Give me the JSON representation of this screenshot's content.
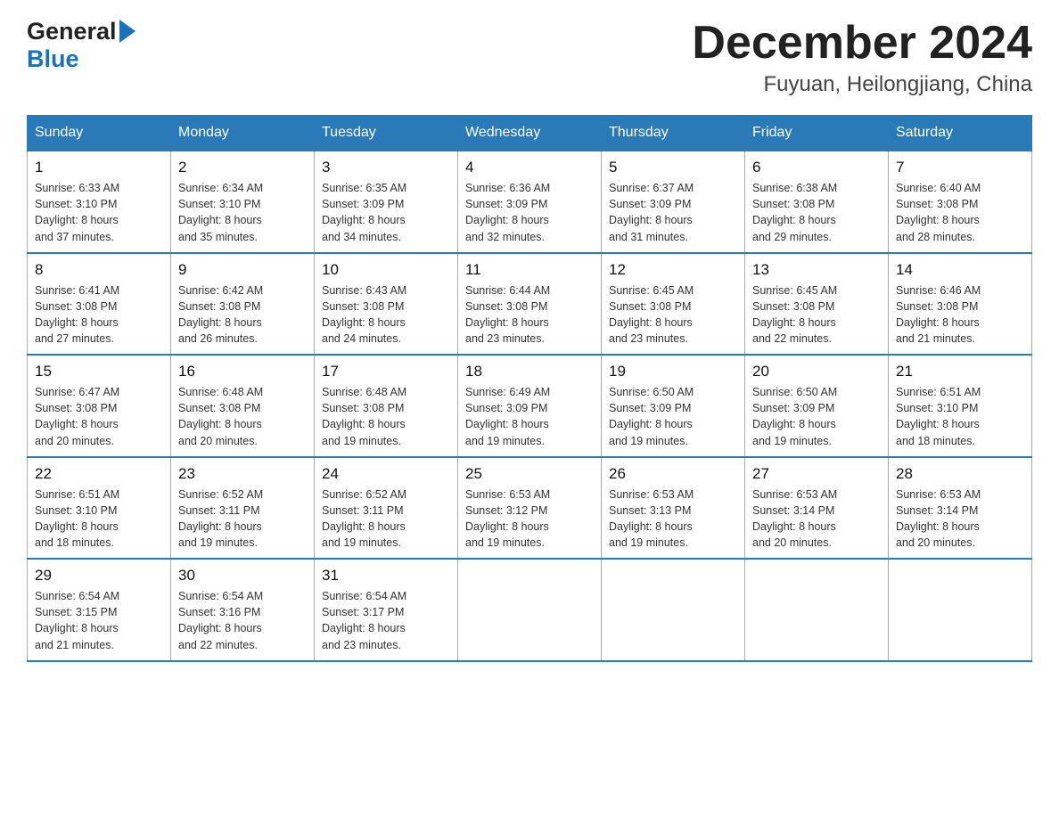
{
  "header": {
    "logo_general": "General",
    "logo_blue": "Blue",
    "month_title": "December 2024",
    "location": "Fuyuan, Heilongjiang, China"
  },
  "weekdays": [
    "Sunday",
    "Monday",
    "Tuesday",
    "Wednesday",
    "Thursday",
    "Friday",
    "Saturday"
  ],
  "weeks": [
    [
      {
        "day": "1",
        "sunrise": "6:33 AM",
        "sunset": "3:10 PM",
        "daylight": "8 hours and 37 minutes."
      },
      {
        "day": "2",
        "sunrise": "6:34 AM",
        "sunset": "3:10 PM",
        "daylight": "8 hours and 35 minutes."
      },
      {
        "day": "3",
        "sunrise": "6:35 AM",
        "sunset": "3:09 PM",
        "daylight": "8 hours and 34 minutes."
      },
      {
        "day": "4",
        "sunrise": "6:36 AM",
        "sunset": "3:09 PM",
        "daylight": "8 hours and 32 minutes."
      },
      {
        "day": "5",
        "sunrise": "6:37 AM",
        "sunset": "3:09 PM",
        "daylight": "8 hours and 31 minutes."
      },
      {
        "day": "6",
        "sunrise": "6:38 AM",
        "sunset": "3:08 PM",
        "daylight": "8 hours and 29 minutes."
      },
      {
        "day": "7",
        "sunrise": "6:40 AM",
        "sunset": "3:08 PM",
        "daylight": "8 hours and 28 minutes."
      }
    ],
    [
      {
        "day": "8",
        "sunrise": "6:41 AM",
        "sunset": "3:08 PM",
        "daylight": "8 hours and 27 minutes."
      },
      {
        "day": "9",
        "sunrise": "6:42 AM",
        "sunset": "3:08 PM",
        "daylight": "8 hours and 26 minutes."
      },
      {
        "day": "10",
        "sunrise": "6:43 AM",
        "sunset": "3:08 PM",
        "daylight": "8 hours and 24 minutes."
      },
      {
        "day": "11",
        "sunrise": "6:44 AM",
        "sunset": "3:08 PM",
        "daylight": "8 hours and 23 minutes."
      },
      {
        "day": "12",
        "sunrise": "6:45 AM",
        "sunset": "3:08 PM",
        "daylight": "8 hours and 23 minutes."
      },
      {
        "day": "13",
        "sunrise": "6:45 AM",
        "sunset": "3:08 PM",
        "daylight": "8 hours and 22 minutes."
      },
      {
        "day": "14",
        "sunrise": "6:46 AM",
        "sunset": "3:08 PM",
        "daylight": "8 hours and 21 minutes."
      }
    ],
    [
      {
        "day": "15",
        "sunrise": "6:47 AM",
        "sunset": "3:08 PM",
        "daylight": "8 hours and 20 minutes."
      },
      {
        "day": "16",
        "sunrise": "6:48 AM",
        "sunset": "3:08 PM",
        "daylight": "8 hours and 20 minutes."
      },
      {
        "day": "17",
        "sunrise": "6:48 AM",
        "sunset": "3:08 PM",
        "daylight": "8 hours and 19 minutes."
      },
      {
        "day": "18",
        "sunrise": "6:49 AM",
        "sunset": "3:09 PM",
        "daylight": "8 hours and 19 minutes."
      },
      {
        "day": "19",
        "sunrise": "6:50 AM",
        "sunset": "3:09 PM",
        "daylight": "8 hours and 19 minutes."
      },
      {
        "day": "20",
        "sunrise": "6:50 AM",
        "sunset": "3:09 PM",
        "daylight": "8 hours and 19 minutes."
      },
      {
        "day": "21",
        "sunrise": "6:51 AM",
        "sunset": "3:10 PM",
        "daylight": "8 hours and 18 minutes."
      }
    ],
    [
      {
        "day": "22",
        "sunrise": "6:51 AM",
        "sunset": "3:10 PM",
        "daylight": "8 hours and 18 minutes."
      },
      {
        "day": "23",
        "sunrise": "6:52 AM",
        "sunset": "3:11 PM",
        "daylight": "8 hours and 19 minutes."
      },
      {
        "day": "24",
        "sunrise": "6:52 AM",
        "sunset": "3:11 PM",
        "daylight": "8 hours and 19 minutes."
      },
      {
        "day": "25",
        "sunrise": "6:53 AM",
        "sunset": "3:12 PM",
        "daylight": "8 hours and 19 minutes."
      },
      {
        "day": "26",
        "sunrise": "6:53 AM",
        "sunset": "3:13 PM",
        "daylight": "8 hours and 19 minutes."
      },
      {
        "day": "27",
        "sunrise": "6:53 AM",
        "sunset": "3:14 PM",
        "daylight": "8 hours and 20 minutes."
      },
      {
        "day": "28",
        "sunrise": "6:53 AM",
        "sunset": "3:14 PM",
        "daylight": "8 hours and 20 minutes."
      }
    ],
    [
      {
        "day": "29",
        "sunrise": "6:54 AM",
        "sunset": "3:15 PM",
        "daylight": "8 hours and 21 minutes."
      },
      {
        "day": "30",
        "sunrise": "6:54 AM",
        "sunset": "3:16 PM",
        "daylight": "8 hours and 22 minutes."
      },
      {
        "day": "31",
        "sunrise": "6:54 AM",
        "sunset": "3:17 PM",
        "daylight": "8 hours and 23 minutes."
      },
      null,
      null,
      null,
      null
    ]
  ],
  "labels": {
    "sunrise": "Sunrise:",
    "sunset": "Sunset:",
    "daylight": "Daylight:"
  }
}
